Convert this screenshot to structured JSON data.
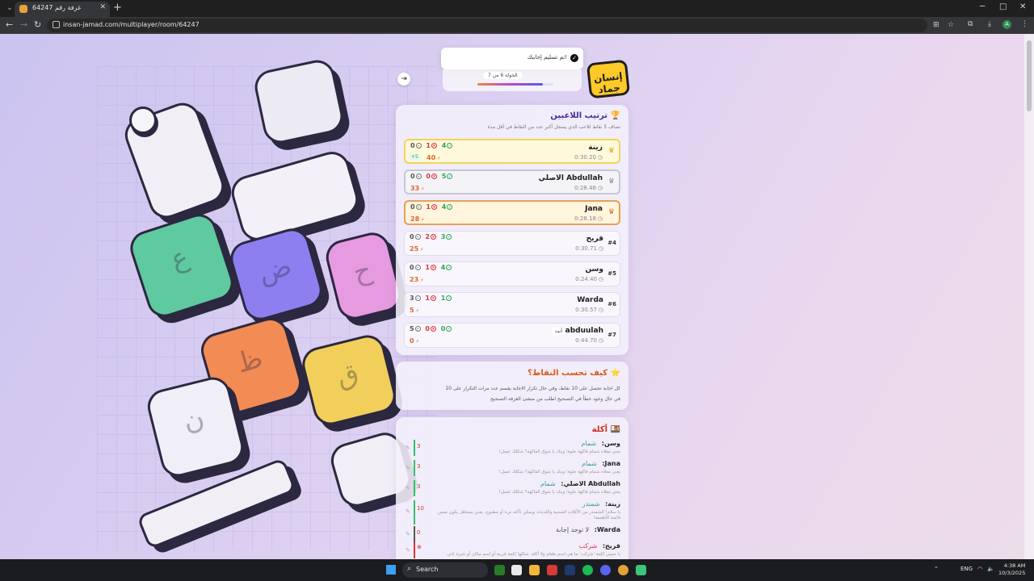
{
  "browser": {
    "tab_title": "غرفة رقم 64247",
    "tab_close": "✕",
    "new_tab": "+",
    "url": "insan-jamad.com/multiplayer/room/64247"
  },
  "page": {
    "toast": "تم تسليم إجابتك!",
    "round_label": "الجولة 6 من 7",
    "round_progress": 0.857,
    "logo_text": "إنسان جماد",
    "leaderboard_title": "ترتيب اللاعبين",
    "leaderboard_subtitle": "تضاف 5 نقاط للاعب الذي يسجل أكبر عدد من النقاط في أقل مدة",
    "players": [
      {
        "name": "زينة",
        "time": "0:30.20",
        "rank": "1",
        "right": "4",
        "wrong": "1",
        "skip": "0",
        "points": "40",
        "bonus": "+5"
      },
      {
        "name": "Abdullah الاصلي",
        "time": "0:28.48",
        "rank": "2",
        "right": "5",
        "wrong": "0",
        "skip": "0",
        "points": "33"
      },
      {
        "name": "Jana",
        "time": "0:28.18",
        "rank": "3",
        "right": "4",
        "wrong": "1",
        "skip": "0",
        "points": "28"
      },
      {
        "name": "قريح",
        "time": "0:30.71",
        "rank": "#4",
        "right": "3",
        "wrong": "2",
        "skip": "0",
        "points": "25"
      },
      {
        "name": "وسن",
        "time": "0:24.40",
        "rank": "#5",
        "right": "4",
        "wrong": "1",
        "skip": "0",
        "points": "23"
      },
      {
        "name": "Warda",
        "time": "0:30.57",
        "rank": "#6",
        "right": "1",
        "wrong": "1",
        "skip": "3",
        "points": "5"
      },
      {
        "name": "abduulah",
        "time": "0:44.70",
        "rank": "#7",
        "right": "0",
        "wrong": "0",
        "skip": "5",
        "points": "0",
        "you": "أنت"
      }
    ],
    "rules_title": "كيف تحسب النقاط؟",
    "rules": [
      "كل اجابة تحصل على 10 نقاط، وفي حال تكرار الاجابة يقسم عدد مرات التكرار على 10",
      "في حال وجود خطأ في التصحيح اطلب من منشئ الغرفة التصحيح"
    ],
    "category_title": "أكلة",
    "answers": [
      {
        "player": "وسن:",
        "word": "شمام",
        "points": "3",
        "desc": "يعني معلاه شمام فاكهة حلوة؛ وينك يا شوق الفاكهة؟ شكلك عسل!"
      },
      {
        "player": "Jana:",
        "word": "شمام",
        "points": "3",
        "desc": "يعني معلاه شمام فاكهة حلوة؛ وينك يا شوق الفاكهة؟ شكلك عسل!"
      },
      {
        "player": "Abdullah الاصلي:",
        "word": "شمام",
        "points": "3",
        "desc": "يعني معلاه شمام فاكهة حلوة؛ وينك يا شوق الفاكهة؟ شكلك عسل!"
      },
      {
        "player": "زينة:",
        "word": "شمندر",
        "points": "10",
        "desc": "يا سلام! الشمندر من الأكلات الصحية واللذيذة، ويمكن تأكله نيء أو مطبوخ. يعني يستاهل يكون ضمن قائمة الأطعمة!"
      },
      {
        "player": "Warda:",
        "word": "لا توجد إجابة",
        "points": "0",
        "desc": ""
      },
      {
        "player": "قريح:",
        "word": "شركب",
        "points": "",
        "desc": "يا حبيبي كلمة 'شركب' ما هي اسم طعام ولا أكلة. شكلها كلمة غريبة أو اسم مكان أو شيء ثاني"
      }
    ]
  },
  "taskbar": {
    "search_placeholder": "Search",
    "lang": "ENG",
    "time": "4:38 AM",
    "date": "10/3/2025"
  }
}
